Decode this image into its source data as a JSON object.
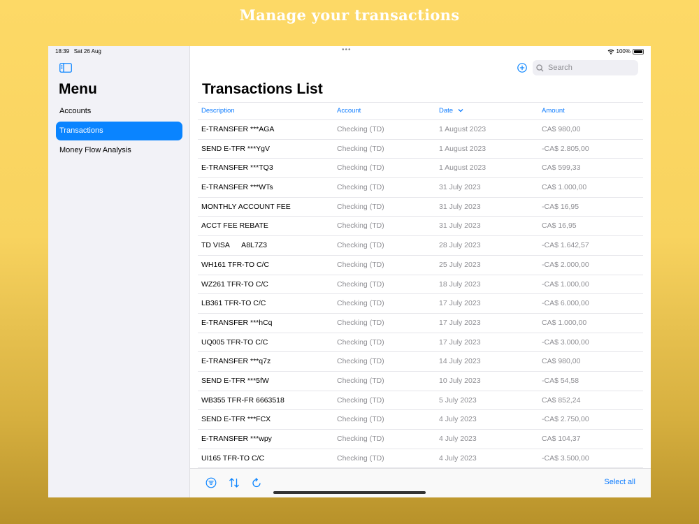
{
  "headline": "Manage your transactions",
  "status": {
    "time": "18:39",
    "date": "Sat 26 Aug",
    "battery": "100%"
  },
  "sidebar": {
    "title": "Menu",
    "items": [
      {
        "label": "Accounts",
        "active": false
      },
      {
        "label": "Transactions",
        "active": true
      },
      {
        "label": "Money Flow Analysis",
        "active": false
      }
    ]
  },
  "search": {
    "placeholder": "Search"
  },
  "main": {
    "title": "Transactions List"
  },
  "table": {
    "columns": [
      "Description",
      "Account",
      "Date",
      "Amount"
    ],
    "rows": [
      [
        "E-TRANSFER ***AGA",
        "Checking (TD)",
        "1 August 2023",
        "CA$ 980,00"
      ],
      [
        "SEND E-TFR ***YgV",
        "Checking (TD)",
        "1 August 2023",
        "-CA$ 2.805,00"
      ],
      [
        "E-TRANSFER ***TQ3",
        "Checking (TD)",
        "1 August 2023",
        "CA$ 599,33"
      ],
      [
        "E-TRANSFER ***WTs",
        "Checking (TD)",
        "31 July 2023",
        "CA$ 1.000,00"
      ],
      [
        "MONTHLY ACCOUNT FEE",
        "Checking (TD)",
        "31 July 2023",
        "-CA$ 16,95"
      ],
      [
        "ACCT FEE REBATE",
        "Checking (TD)",
        "31 July 2023",
        "CA$ 16,95"
      ],
      [
        "TD VISA      A8L7Z3",
        "Checking (TD)",
        "28 July 2023",
        "-CA$ 1.642,57"
      ],
      [
        "WH161 TFR-TO C/C",
        "Checking (TD)",
        "25 July 2023",
        "-CA$ 2.000,00"
      ],
      [
        "WZ261 TFR-TO C/C",
        "Checking (TD)",
        "18 July 2023",
        "-CA$ 1.000,00"
      ],
      [
        "LB361 TFR-TO C/C",
        "Checking (TD)",
        "17 July 2023",
        "-CA$ 6.000,00"
      ],
      [
        "E-TRANSFER ***hCq",
        "Checking (TD)",
        "17 July 2023",
        "CA$ 1.000,00"
      ],
      [
        "UQ005 TFR-TO C/C",
        "Checking (TD)",
        "17 July 2023",
        "-CA$ 3.000,00"
      ],
      [
        "E-TRANSFER ***q7z",
        "Checking (TD)",
        "14 July 2023",
        "CA$ 980,00"
      ],
      [
        "SEND E-TFR ***5fW",
        "Checking (TD)",
        "10 July 2023",
        "-CA$ 54,58"
      ],
      [
        "WB355 TFR-FR 6663518",
        "Checking (TD)",
        "5 July 2023",
        "CA$ 852,24"
      ],
      [
        "SEND E-TFR ***FCX",
        "Checking (TD)",
        "4 July 2023",
        "-CA$ 2.750,00"
      ],
      [
        "E-TRANSFER ***wpy",
        "Checking (TD)",
        "4 July 2023",
        "CA$ 104,37"
      ],
      [
        "UI165 TFR-TO C/C",
        "Checking (TD)",
        "4 July 2023",
        "-CA$ 3.500,00"
      ]
    ]
  },
  "toolbar": {
    "select_all": "Select all"
  },
  "colors": {
    "accent": "#0A84FF",
    "sidebar_bg": "#F2F2F7",
    "backdrop": "#FDD966"
  }
}
